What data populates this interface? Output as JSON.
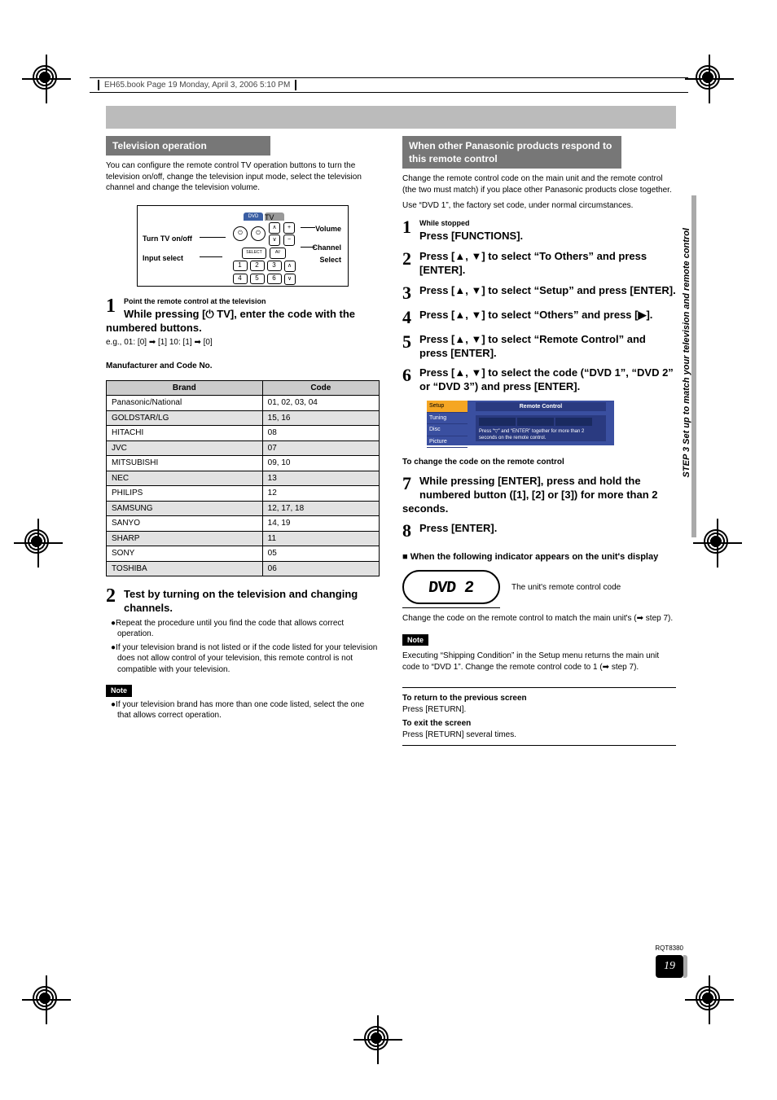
{
  "book_header": {
    "left": "EH65.book  Page 19  Monday, April 3, 2006  5:10 PM",
    "right": ""
  },
  "left_col": {
    "section_title": "Television operation",
    "intro": "You can configure the remote control TV operation buttons to turn the television on/off, change the television input mode, select the television channel and change the television volume.",
    "diagram": {
      "l1": "Turn TV on/off",
      "l2": "Input select",
      "r1": "Volume",
      "r2": "Channel",
      "r3": "Select",
      "tab_dvd": "DVD",
      "tab_tv": "TV"
    },
    "step1": {
      "num": "1",
      "sub": "Point the remote control at the television",
      "title": "While pressing [⏻ TV], enter the code with the numbered buttons.",
      "eg": "e.g.,    01:       [0] ➡ [1]          10:       [1] ➡ [0]"
    },
    "table_caption": "Manufacturer and Code No.",
    "table": {
      "head_brand": "Brand",
      "head_code": "Code",
      "rows": [
        {
          "b": "Panasonic/National",
          "c": "01, 02, 03, 04"
        },
        {
          "b": "GOLDSTAR/LG",
          "c": "15, 16"
        },
        {
          "b": "HITACHI",
          "c": "08"
        },
        {
          "b": "JVC",
          "c": "07"
        },
        {
          "b": "MITSUBISHI",
          "c": "09, 10"
        },
        {
          "b": "NEC",
          "c": "13"
        },
        {
          "b": "PHILIPS",
          "c": "12"
        },
        {
          "b": "SAMSUNG",
          "c": "12, 17, 18"
        },
        {
          "b": "SANYO",
          "c": "14, 19"
        },
        {
          "b": "SHARP",
          "c": "11"
        },
        {
          "b": "SONY",
          "c": "05"
        },
        {
          "b": "TOSHIBA",
          "c": "06"
        }
      ]
    },
    "step2": {
      "num": "2",
      "title": "Test by turning on the television and changing channels.",
      "b1": "●Repeat the procedure until you find the code that allows correct operation.",
      "b2": "●If your television brand is not listed or if the code listed for your television does not allow control of your television, this remote control is not compatible with your television."
    },
    "note_label": "Note",
    "note_text": "●If your television brand has more than one code listed, select the one that allows correct operation."
  },
  "right_col": {
    "section_title": "When other Panasonic products respond to this remote control",
    "intro1": "Change the remote control code on the main unit and the remote control (the two must match) if you place other Panasonic products close together.",
    "intro2": "Use “DVD 1”, the factory set code, under normal circumstances.",
    "steps": [
      {
        "n": "1",
        "sub": "While stopped",
        "t": "Press [FUNCTIONS]."
      },
      {
        "n": "2",
        "t": "Press [▲, ▼] to select “To Others” and press [ENTER]."
      },
      {
        "n": "3",
        "t": "Press [▲, ▼] to select “Setup” and press [ENTER]."
      },
      {
        "n": "4",
        "t": "Press [▲, ▼] to select “Others” and press [▶]."
      },
      {
        "n": "5",
        "t": "Press [▲, ▼] to select “Remote Control” and press [ENTER]."
      },
      {
        "n": "6",
        "t": "Press [▲, ▼] to select the code (“DVD 1”, “DVD 2” or “DVD 3”) and press [ENTER]."
      }
    ],
    "menu": {
      "setup": "Setup",
      "tuning": "Tuning",
      "disc": "Disc",
      "picture": "Picture",
      "banner": "Remote Control",
      "box": "Press “▽” and “ENTER” together for more than 2 seconds on the remote control."
    },
    "change_code": "To change the code on the remote control",
    "step7": {
      "n": "7",
      "t": "While pressing [ENTER], press and hold the numbered button ([1], [2] or [3]) for more than 2 seconds."
    },
    "step8": {
      "n": "8",
      "t": "Press [ENTER]."
    },
    "indicator_head": "When the following indicator appears on the unit's display",
    "lcd_text": "DVD  2",
    "lcd_caption": "The unit's remote control code",
    "after_lcd": "Change the code on the remote control to match the main unit's (➡ step 7).",
    "note_label": "Note",
    "note_text": "Executing “Shipping Condition” in the Setup menu returns the main unit code to “DVD 1”. Change the remote control code to 1 (➡ step 7).",
    "return_head": "To return to the previous screen",
    "return_body": "Press [RETURN].",
    "exit_head": "To exit the screen",
    "exit_body": "Press [RETURN] several times."
  },
  "side_text": "STEP 3 Set up to match your television and remote control",
  "rqt": "RQT8380",
  "page_num": "19"
}
